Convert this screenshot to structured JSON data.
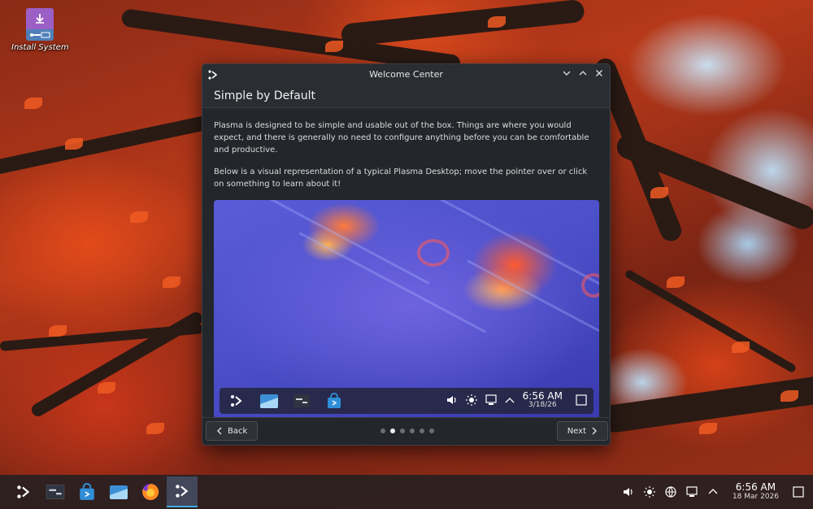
{
  "desktop": {
    "install_icon_label": "Install System"
  },
  "dialog": {
    "window_title": "Welcome Center",
    "heading": "Simple by Default",
    "paragraph1": "Plasma is designed to be simple and usable out of the box. Things are where you would expect, and there is generally no need to configure anything before you can be comfortable and productive.",
    "paragraph2": "Below is a visual representation of a typical Plasma Desktop; move the pointer over or click on something to learn about it!",
    "preview_panel": {
      "time": "6:56 AM",
      "date": "3/18/26"
    },
    "back_label": "Back",
    "next_label": "Next",
    "page_count": 6,
    "current_page": 2
  },
  "taskbar": {
    "apps": [
      "application-launcher-icon",
      "terminal-icon",
      "discover-store-icon",
      "file-manager-icon",
      "firefox-icon",
      "welcome-center-icon"
    ],
    "time": "6:56 AM",
    "date": "18 Mar 2026"
  },
  "colors": {
    "accent": "#3daee9",
    "dialog_bg": "#23262b",
    "panel_bg": "#282022"
  }
}
